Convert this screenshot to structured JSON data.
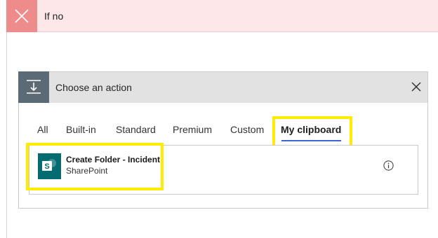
{
  "condition_branch": {
    "label": "If no"
  },
  "action_panel": {
    "title": "Choose an action",
    "tabs": [
      {
        "label": "All"
      },
      {
        "label": "Built-in"
      },
      {
        "label": "Standard"
      },
      {
        "label": "Premium"
      },
      {
        "label": "Custom"
      },
      {
        "label": "My clipboard",
        "selected": true
      }
    ],
    "items": [
      {
        "name": "Create Folder - Incident",
        "connector": "SharePoint",
        "icon": "sharepoint-icon"
      }
    ]
  },
  "colors": {
    "condition_header_bg": "#fde7e9",
    "condition_icon_bg": "#ee8c8c",
    "action_header_bg": "#e2e2e2",
    "action_icon_bg": "#5c6a75",
    "tab_underline": "#3a66d0",
    "sharepoint": "#036c70",
    "highlight": "#ffec00"
  },
  "icons": {
    "condition": "close-x-icon",
    "action": "insert-step-icon",
    "close": "close-icon",
    "info": "info-icon"
  }
}
